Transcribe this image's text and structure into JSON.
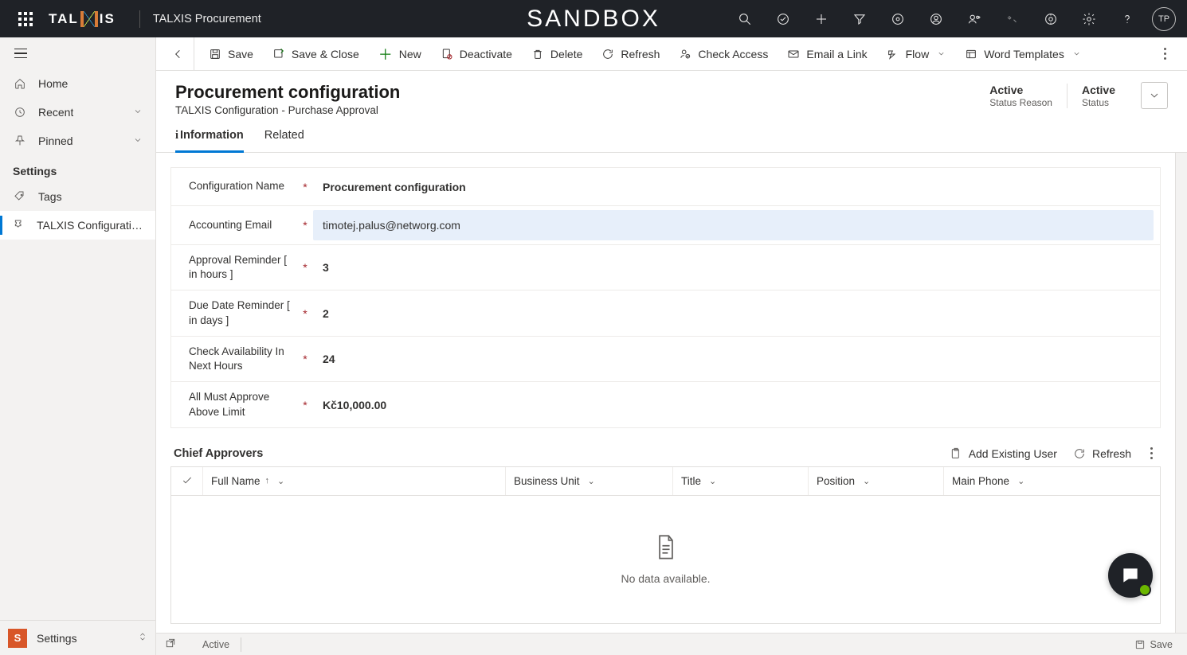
{
  "topbar": {
    "app": "TALXIS Procurement",
    "env": "SANDBOX",
    "avatar": "TP",
    "logo_left": "TAL",
    "logo_right": "IS"
  },
  "sidebar": {
    "home": "Home",
    "recent": "Recent",
    "pinned": "Pinned",
    "section": "Settings",
    "tags": "Tags",
    "config": "TALXIS Configuration…",
    "area": "Settings",
    "area_initial": "S"
  },
  "commands": {
    "save": "Save",
    "saveclose": "Save & Close",
    "new": "New",
    "deactivate": "Deactivate",
    "delete": "Delete",
    "refresh": "Refresh",
    "checkaccess": "Check Access",
    "emaillink": "Email a Link",
    "flow": "Flow",
    "wordtemplates": "Word Templates"
  },
  "header": {
    "title": "Procurement configuration",
    "subtitle": "TALXIS Configuration - Purchase Approval",
    "status1_val": "Active",
    "status1_lbl": "Status Reason",
    "status2_val": "Active",
    "status2_lbl": "Status"
  },
  "tabs": {
    "info": "Information",
    "related": "Related"
  },
  "fields": {
    "name_lbl": "Configuration Name",
    "name_val": "Procurement configuration",
    "email_lbl": "Accounting Email",
    "email_val": "timotej.palus@networg.com",
    "approval_lbl": "Approval Reminder [ in hours ]",
    "approval_val": "3",
    "due_lbl": "Due Date Reminder [ in days ]",
    "due_val": "2",
    "avail_lbl": "Check Availability In Next Hours",
    "avail_val": "24",
    "limit_lbl": "All Must Approve Above Limit",
    "limit_val": "Kč10,000.00"
  },
  "subgrid": {
    "title": "Chief Approvers",
    "add": "Add Existing User",
    "refresh": "Refresh",
    "cols": {
      "fullname": "Full Name",
      "bu": "Business Unit",
      "title": "Title",
      "position": "Position",
      "phone": "Main Phone"
    },
    "empty": "No data available."
  },
  "footer": {
    "status": "Active",
    "save": "Save"
  }
}
